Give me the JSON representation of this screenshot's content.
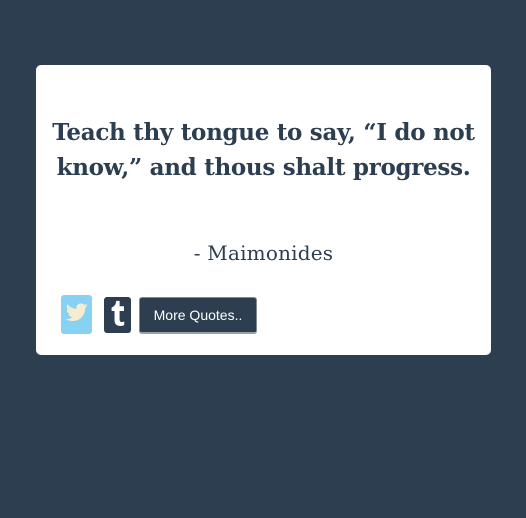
{
  "quote": {
    "text": "Teach thy tongue to say, “I do not know,” and thous shalt progress.",
    "author": "- Maimonides"
  },
  "buttons": {
    "twitter_icon": "twitter-bird-icon",
    "tumblr_icon": "tumblr-t-icon",
    "more_quotes_label": "More Quotes.."
  },
  "colors": {
    "background": "#2c3e50",
    "card": "#ffffff",
    "text": "#2c3e50",
    "twitter": "#87d2f3",
    "tumblr": "#2c3e50",
    "button": "#2c3e50"
  }
}
